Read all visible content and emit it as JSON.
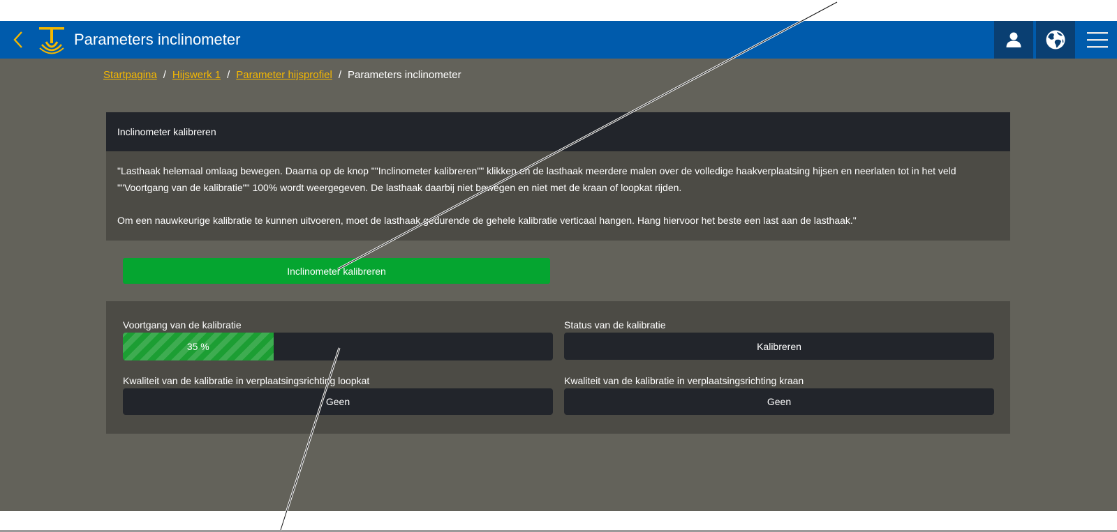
{
  "header": {
    "title": "Parameters inclinometer",
    "back_icon": "chevron-left-icon",
    "logo_icon": "crane-hook-logo-icon",
    "user_icon": "user-icon",
    "language_icon": "globe-icon",
    "menu_icon": "hamburger-menu-icon",
    "accent_color": "#f5b800",
    "bar_color": "#005bac"
  },
  "breadcrumb": {
    "items": [
      {
        "label": "Startpagina"
      },
      {
        "label": "Hijswerk 1"
      },
      {
        "label": "Parameter hijsprofiel"
      }
    ],
    "current": "Parameters inclinometer",
    "separator": "/"
  },
  "calibration_card": {
    "title": "Inclinometer kalibreren",
    "paragraph_1": "\"Lasthaak helemaal omlaag bewegen. Daarna op de knop \"\"Inclinometer kalibreren\"\" klikken en de lasthaak meerdere malen over de volledige haakverplaatsing hijsen en neerlaten tot in het veld \"\"Voortgang van de kalibratie\"\" 100% wordt weergegeven. De lasthaak daarbij niet bewegen en niet met de kraan of loopkat rijden.",
    "paragraph_2": "Om een nauwkeurige kalibratie te kunnen uitvoeren, moet de lasthaak gedurende de gehele kalibratie verticaal hangen. Hang hiervoor het beste een last aan de lasthaak.\""
  },
  "calibrate_button": {
    "label": "Inclinometer kalibreren",
    "color": "#05a530"
  },
  "status_panel": {
    "progress": {
      "label": "Voortgang van de kalibratie",
      "value_text": "35 %",
      "fraction": 0.35,
      "color": "#1c9e33"
    },
    "status": {
      "label": "Status van de kalibratie",
      "value": "Kalibreren"
    },
    "quality_trolley": {
      "label": "Kwaliteit van de kalibratie in verplaatsingsrichting loopkat",
      "value": "Geen"
    },
    "quality_crane": {
      "label": "Kwaliteit van de kalibratie in verplaatsingsrichting kraan",
      "value": "Geen"
    }
  }
}
